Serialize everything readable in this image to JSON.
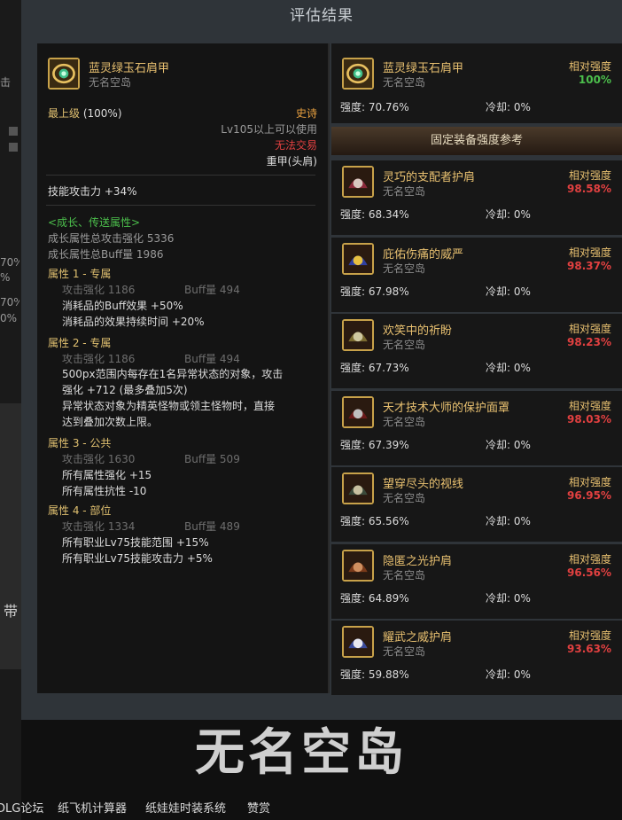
{
  "page": {
    "title": "评估结果"
  },
  "background_fragments": [
    "击",
    "70%",
    "%",
    "70%",
    "0%",
    "带"
  ],
  "detail": {
    "item_name": "蓝灵绿玉石肩甲",
    "item_sub": "无名空岛",
    "grade": "最上级",
    "grade_pct": "(100%)",
    "rarity": "史诗",
    "level_req": "Lv105以上可以使用",
    "trade": "无法交易",
    "slot": "重甲(头肩)",
    "skill_atk": "技能攻击力 +34%",
    "growth_header": "<成长、传送属性>",
    "growth_total_atk": "成长属性总攻击强化 5336",
    "growth_total_buff": "成长属性总Buff量 1986",
    "attributes": [
      {
        "title": "属性 1 - 专属",
        "atk": "攻击强化  1186",
        "buff": "Buff量  494",
        "lines": [
          "消耗品的Buff效果 +50%",
          "消耗品的效果持续时间 +20%"
        ]
      },
      {
        "title": "属性 2 - 专属",
        "atk": "攻击强化  1186",
        "buff": "Buff量  494",
        "lines": [
          "500px范围内每存在1名异常状态的对象，攻击",
          "强化 +712 (最多叠加5次)",
          "异常状态对象为精英怪物或领主怪物时，直接",
          "达到叠加次数上限。"
        ]
      },
      {
        "title": "属性 3 - 公共",
        "atk": "攻击强化  1630",
        "buff": "Buff量  509",
        "lines": [
          "所有属性强化 +15",
          "所有属性抗性 -10"
        ]
      },
      {
        "title": "属性 4 - 部位",
        "atk": "攻击强化  1334",
        "buff": "Buff量  489",
        "lines": [
          "所有职业Lv75技能范围 +15%",
          "所有职业Lv75技能攻击力 +5%"
        ]
      }
    ]
  },
  "current": {
    "name": "蓝灵绿玉石肩甲",
    "sub": "无名空岛",
    "rel_label": "相对强度",
    "rel_value": "100%",
    "strength": "强度: 70.76%",
    "cooldown": "冷却: 0%"
  },
  "reference_header": "固定装备强度参考",
  "references": [
    {
      "name": "灵巧的支配者护肩",
      "sub": "无名空岛",
      "rel_label": "相对强度",
      "rel_value": "98.58%",
      "strength": "强度: 68.34%",
      "cooldown": "冷却: 0%",
      "icon": "shoulder-armor-icon"
    },
    {
      "name": "庇佑伤痛的威严",
      "sub": "无名空岛",
      "rel_label": "相对强度",
      "rel_value": "98.37%",
      "strength": "强度: 67.98%",
      "cooldown": "冷却: 0%",
      "icon": "cape-icon"
    },
    {
      "name": "欢笑中的祈盼",
      "sub": "无名空岛",
      "rel_label": "相对强度",
      "rel_value": "98.23%",
      "strength": "强度: 67.73%",
      "cooldown": "冷却: 0%",
      "icon": "armor-icon"
    },
    {
      "name": "天才技术大师的保护面罩",
      "sub": "无名空岛",
      "rel_label": "相对强度",
      "rel_value": "98.03%",
      "strength": "强度: 67.39%",
      "cooldown": "冷却: 0%",
      "icon": "mask-icon"
    },
    {
      "name": "望穿尽头的视线",
      "sub": "无名空岛",
      "rel_label": "相对强度",
      "rel_value": "96.95%",
      "strength": "强度: 65.56%",
      "cooldown": "冷却: 0%",
      "icon": "helmet-icon"
    },
    {
      "name": "隐匿之光护肩",
      "sub": "无名空岛",
      "rel_label": "相对强度",
      "rel_value": "96.56%",
      "strength": "强度: 64.89%",
      "cooldown": "冷却: 0%",
      "icon": "shoulder-pad-icon"
    },
    {
      "name": "耀武之威护肩",
      "sub": "无名空岛",
      "rel_label": "相对强度",
      "rel_value": "93.63%",
      "strength": "强度: 59.88%",
      "cooldown": "冷却: 0%",
      "icon": "winged-helmet-icon"
    }
  ],
  "logo_text": "无名空岛",
  "footer": {
    "links": [
      "DLG论坛",
      "纸飞机计算器",
      "纸娃娃时装系统",
      "赞赏"
    ]
  },
  "colors": {
    "modal_bg": "#2f3439",
    "gold": "#e0c070",
    "green": "#4cbf4c",
    "red": "#e04040",
    "epic": "#e8a040"
  }
}
